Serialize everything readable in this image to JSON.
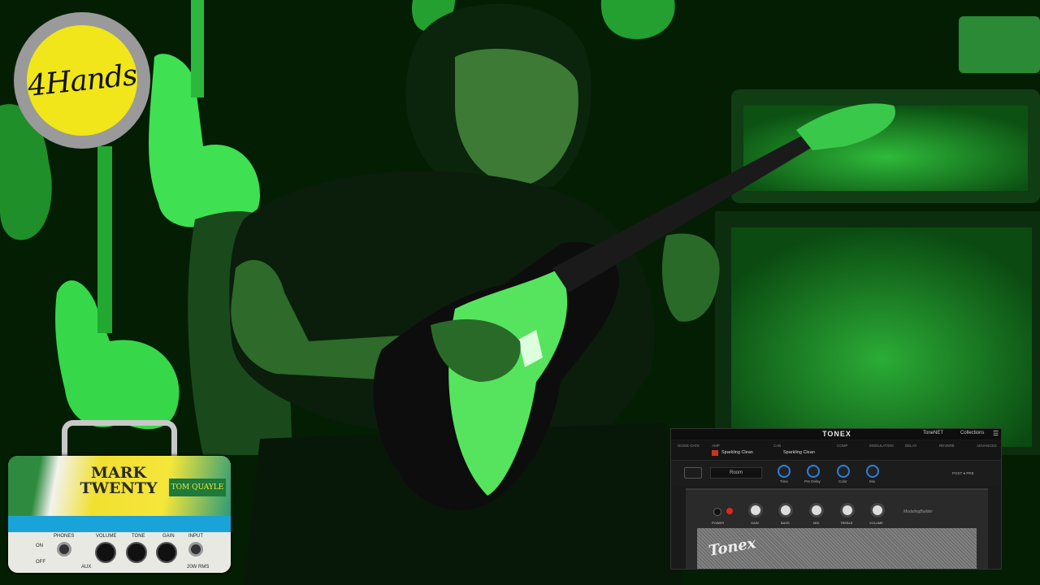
{
  "logo": {
    "text": "4Hands"
  },
  "amp": {
    "title_line1": "MARK",
    "title_line2": "TWENTY",
    "signature": "TOM QUAYLE",
    "labels": {
      "phones": "PHONES",
      "volume": "VOLUME",
      "tone": "TONE",
      "gain": "GAIN",
      "input": "INPUT",
      "aux": "AUX",
      "on": "ON",
      "off": "OFF",
      "power": "20W RMS"
    }
  },
  "tonex": {
    "brand": "TONEX",
    "tonenet": "ToneNET",
    "collections": "Collections",
    "chain": {
      "noise_gate": "NOISE GATE",
      "amp": "AMP",
      "amp_preset": "Sparkling Clean",
      "cab": "CAB",
      "cab_preset": "Sparkling Clean",
      "comp": "COMP",
      "modulation": "MODULATION",
      "delay": "DELAY",
      "reverb": "REVERB",
      "advanced": "ADVANCED"
    },
    "room": "Room",
    "ctrl_knobs": [
      "Time",
      "Pre Delay",
      "Color",
      "Mix"
    ],
    "post_label": "POST",
    "pre_label": "PRE",
    "amp_knobs": [
      "GAIN",
      "BASS",
      "MID",
      "TREBLE",
      "VOLUME"
    ],
    "power_label": "POWER",
    "mfg": "ModelingBuilder",
    "grille_logo": "Tonex"
  },
  "colors": {
    "scene_green": "#2bd43a",
    "logo_yellow": "#f0e61a",
    "tonex_bg": "#1a1a1a",
    "knob_blue": "#2f7fd8"
  }
}
